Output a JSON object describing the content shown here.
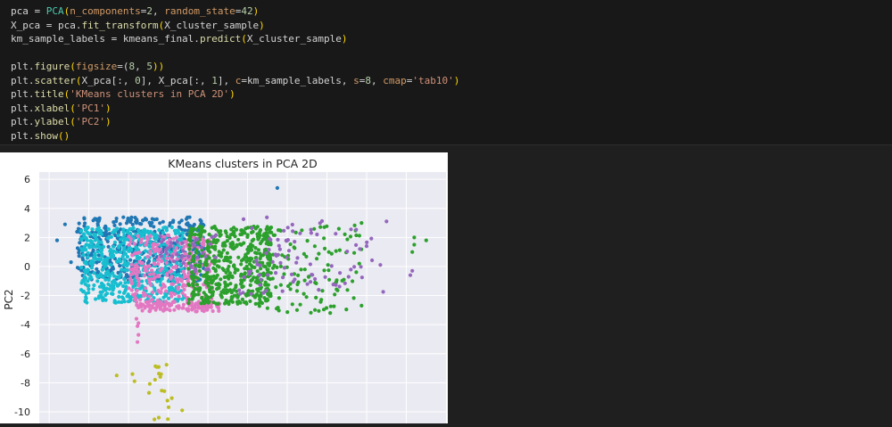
{
  "code_cell": {
    "lines": [
      [
        [
          "pca",
          "id"
        ],
        [
          " = ",
          "op"
        ],
        [
          "PCA",
          "cls"
        ],
        [
          "(",
          "br"
        ],
        [
          "n_components",
          "kw"
        ],
        [
          "=",
          "op"
        ],
        [
          "2",
          "num"
        ],
        [
          ", ",
          "op"
        ],
        [
          "random_state",
          "kw"
        ],
        [
          "=",
          "op"
        ],
        [
          "42",
          "num"
        ],
        [
          ")",
          "br"
        ]
      ],
      [
        [
          "X_pca",
          "id"
        ],
        [
          " = pca.",
          "op"
        ],
        [
          "fit_transform",
          "fn"
        ],
        [
          "(",
          "br"
        ],
        [
          "X_cluster_sample",
          "id"
        ],
        [
          ")",
          "br"
        ]
      ],
      [
        [
          "km_sample_labels",
          "id"
        ],
        [
          " = kmeans_final.",
          "op"
        ],
        [
          "predict",
          "fn"
        ],
        [
          "(",
          "br"
        ],
        [
          "X_cluster_sample",
          "id"
        ],
        [
          ")",
          "br"
        ]
      ],
      [],
      [
        [
          "plt.",
          "id"
        ],
        [
          "figure",
          "fn"
        ],
        [
          "(",
          "br"
        ],
        [
          "figsize",
          "kw"
        ],
        [
          "=(",
          "op"
        ],
        [
          "8",
          "num"
        ],
        [
          ", ",
          "op"
        ],
        [
          "5",
          "num"
        ],
        [
          "))",
          "br"
        ]
      ],
      [
        [
          "plt.",
          "id"
        ],
        [
          "scatter",
          "fn"
        ],
        [
          "(",
          "br"
        ],
        [
          "X_pca[:, ",
          "id"
        ],
        [
          "0",
          "num"
        ],
        [
          "], X_pca[:, ",
          "id"
        ],
        [
          "1",
          "num"
        ],
        [
          "], ",
          "id"
        ],
        [
          "c",
          "kw"
        ],
        [
          "=km_sample_labels, ",
          "op"
        ],
        [
          "s",
          "kw"
        ],
        [
          "=",
          "op"
        ],
        [
          "8",
          "num"
        ],
        [
          ", ",
          "op"
        ],
        [
          "cmap",
          "kw"
        ],
        [
          "=",
          "op"
        ],
        [
          "'tab10'",
          "str"
        ],
        [
          ")",
          "br"
        ]
      ],
      [
        [
          "plt.",
          "id"
        ],
        [
          "title",
          "fn"
        ],
        [
          "(",
          "br"
        ],
        [
          "'KMeans clusters in PCA 2D'",
          "str"
        ],
        [
          ")",
          "br"
        ]
      ],
      [
        [
          "plt.",
          "id"
        ],
        [
          "xlabel",
          "fn"
        ],
        [
          "(",
          "br"
        ],
        [
          "'PC1'",
          "str"
        ],
        [
          ")",
          "br"
        ]
      ],
      [
        [
          "plt.",
          "id"
        ],
        [
          "ylabel",
          "fn"
        ],
        [
          "(",
          "br"
        ],
        [
          "'PC2'",
          "str"
        ],
        [
          ")",
          "br"
        ]
      ],
      [
        [
          "plt.",
          "id"
        ],
        [
          "show",
          "fn"
        ],
        [
          "()",
          "br"
        ]
      ]
    ]
  },
  "chart_data": {
    "type": "scatter",
    "title": "KMeans clusters in PCA 2D",
    "xlabel": "",
    "ylabel": "PC2",
    "ylim": [
      -10.8,
      6.5
    ],
    "xlim": [
      -5.5,
      15
    ],
    "y_ticks": [
      6,
      4,
      2,
      0,
      -2,
      -4,
      -6,
      -8,
      -10
    ],
    "x_gridlines": [
      -5,
      -3,
      -1,
      1,
      3,
      5,
      7,
      9,
      11,
      13
    ],
    "grid": true,
    "legend": "none",
    "background": "#eaeaf2",
    "series": [
      {
        "color": "#1f77b4",
        "regions": [
          {
            "x": [
              -3.6,
              2.8
            ],
            "y": [
              -1.0,
              3.4
            ],
            "n": 460
          }
        ],
        "points": [
          [
            6.5,
            5.4
          ],
          [
            -4.2,
            2.9
          ],
          [
            -4.6,
            1.8
          ],
          [
            -3.9,
            0.3
          ]
        ]
      },
      {
        "color": "#17becf",
        "regions": [
          {
            "x": [
              -3.4,
              1.8
            ],
            "y": [
              -2.5,
              2.7
            ],
            "n": 560
          }
        ]
      },
      {
        "color": "#e377c2",
        "regions": [
          {
            "x": [
              -1.0,
              3.2
            ],
            "y": [
              -2.9,
              2.2
            ],
            "n": 300
          },
          {
            "x": [
              -0.6,
              3.6
            ],
            "y": [
              -3.1,
              -2.4
            ],
            "n": 90
          }
        ],
        "points": [
          [
            -0.6,
            -3.6
          ],
          [
            -0.55,
            -4.1
          ],
          [
            -0.5,
            -4.7
          ],
          [
            -0.55,
            -5.2
          ],
          [
            -0.5,
            -3.9
          ]
        ]
      },
      {
        "color": "#2ca02c",
        "regions": [
          {
            "x": [
              2.0,
              6.2
            ],
            "y": [
              -2.6,
              2.8
            ],
            "n": 520
          },
          {
            "x": [
              5.5,
              10.8
            ],
            "y": [
              -3.2,
              3.1
            ],
            "n": 130
          }
        ],
        "points": [
          [
            14.0,
            1.8
          ],
          [
            13.4,
            2.0
          ],
          [
            13.4,
            1.5
          ],
          [
            13.3,
            1.0
          ],
          [
            9.6,
            2.6
          ]
        ]
      },
      {
        "color": "#9467bd",
        "regions": [
          {
            "x": [
              4.5,
              12.0
            ],
            "y": [
              -2.0,
              3.4
            ],
            "n": 90
          },
          {
            "x": [
              0.5,
              3.5
            ],
            "y": [
              -0.5,
              2.2
            ],
            "n": 40
          }
        ],
        "points": [
          [
            13.2,
            -0.6
          ],
          [
            13.3,
            -0.3
          ],
          [
            12.0,
            3.1
          ]
        ]
      },
      {
        "color": "#bcbd22",
        "regions": [
          {
            "x": [
              0.0,
              1.2
            ],
            "y": [
              -10.6,
              -6.5
            ],
            "n": 18
          }
        ],
        "points": [
          [
            -1.6,
            -7.5
          ],
          [
            -0.8,
            -7.4
          ],
          [
            -0.7,
            -7.9
          ],
          [
            1.7,
            -9.9
          ],
          [
            0.6,
            -7.6
          ]
        ]
      }
    ]
  }
}
